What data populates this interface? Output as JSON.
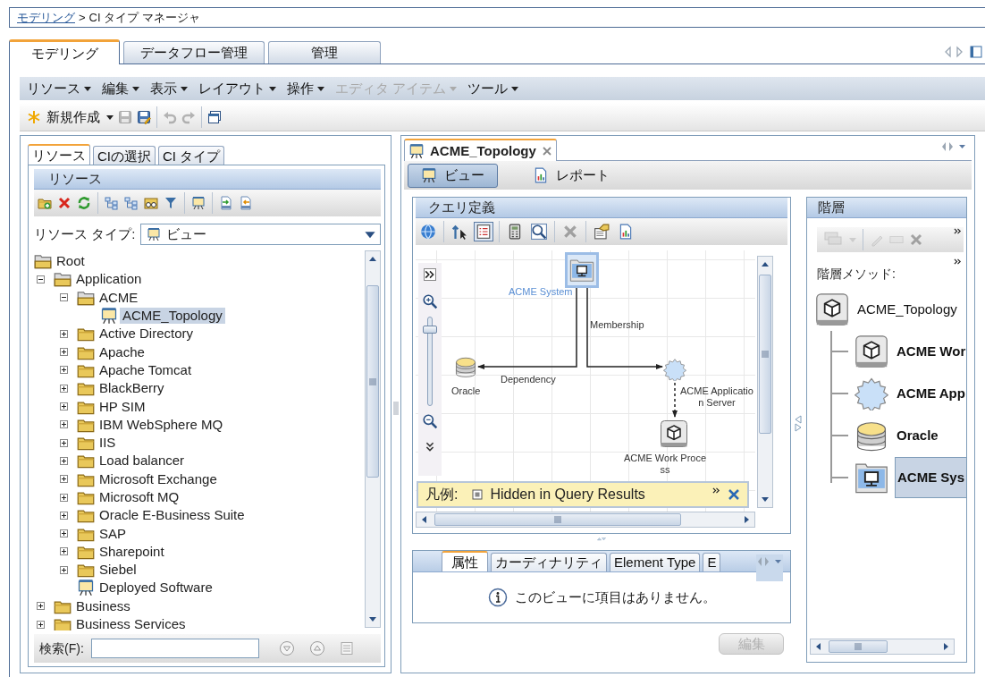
{
  "breadcrumb": {
    "items": [
      {
        "text": "モデリング",
        "link": true
      },
      {
        "text": "CI タイプ マネージャ",
        "link": false
      }
    ],
    "separator": ">"
  },
  "main_tabs": [
    {
      "label": "モデリング",
      "selected": true
    },
    {
      "label": "データフロー管理",
      "selected": false
    },
    {
      "label": "管理",
      "selected": false
    }
  ],
  "menu": [
    {
      "label": "リソース",
      "disabled": false
    },
    {
      "label": "編集",
      "disabled": false
    },
    {
      "label": "表示",
      "disabled": false
    },
    {
      "label": "レイアウト",
      "disabled": false
    },
    {
      "label": "操作",
      "disabled": false
    },
    {
      "label": "エディタ アイテム",
      "disabled": true
    },
    {
      "label": "ツール",
      "disabled": false
    }
  ],
  "toolbar": [
    {
      "kind": "new",
      "label": "新規作成",
      "disabled": false
    },
    {
      "kind": "save",
      "disabled": true
    },
    {
      "kind": "save_as",
      "disabled": false
    },
    {
      "kind": "undo",
      "disabled": true
    },
    {
      "kind": "redo",
      "disabled": true
    },
    {
      "kind": "window",
      "disabled": false
    }
  ],
  "left_panel": {
    "tabs": [
      {
        "label": "リソース",
        "selected": true
      },
      {
        "label": "CIの選択",
        "selected": false
      },
      {
        "label": "CI タイプ",
        "selected": false
      }
    ],
    "title": "リソース",
    "resource_type": {
      "label": "リソース タイプ:",
      "value": "ビュー"
    },
    "tree": [
      {
        "label": "Root",
        "kind": "folder",
        "expanded": true,
        "selected": false,
        "children": [
          {
            "label": "Application",
            "kind": "folder",
            "expanded": true,
            "selected": false,
            "children": [
              {
                "label": "ACME",
                "kind": "folder",
                "expanded": true,
                "selected": false,
                "children": [
                  {
                    "label": "ACME_Topology",
                    "kind": "view",
                    "selected": true
                  }
                ]
              },
              {
                "label": "Active Directory",
                "kind": "folder",
                "expanded": false,
                "selected": false
              },
              {
                "label": "Apache",
                "kind": "folder",
                "expanded": false,
                "selected": false
              },
              {
                "label": "Apache Tomcat",
                "kind": "folder",
                "expanded": false,
                "selected": false
              },
              {
                "label": "BlackBerry",
                "kind": "folder",
                "expanded": false,
                "selected": false
              },
              {
                "label": "HP SIM",
                "kind": "folder",
                "expanded": false,
                "selected": false
              },
              {
                "label": "IBM WebSphere MQ",
                "kind": "folder",
                "expanded": false,
                "selected": false
              },
              {
                "label": "IIS",
                "kind": "folder",
                "expanded": false,
                "selected": false
              },
              {
                "label": "Load balancer",
                "kind": "folder",
                "expanded": false,
                "selected": false
              },
              {
                "label": "Microsoft Exchange",
                "kind": "folder",
                "expanded": false,
                "selected": false
              },
              {
                "label": "Microsoft MQ",
                "kind": "folder",
                "expanded": false,
                "selected": false
              },
              {
                "label": "Oracle E-Business Suite",
                "kind": "folder",
                "expanded": false,
                "selected": false
              },
              {
                "label": "SAP",
                "kind": "folder",
                "expanded": false,
                "selected": false
              },
              {
                "label": "Sharepoint",
                "kind": "folder",
                "expanded": false,
                "selected": false
              },
              {
                "label": "Siebel",
                "kind": "folder",
                "expanded": false,
                "selected": false
              },
              {
                "label": "Deployed Software",
                "kind": "view",
                "selected": false
              }
            ]
          },
          {
            "label": "Business",
            "kind": "folder",
            "expanded": false,
            "selected": false
          },
          {
            "label": "Business Services",
            "kind": "folder",
            "expanded": false,
            "selected": false
          }
        ]
      }
    ],
    "search": {
      "label": "検索(F):"
    }
  },
  "editor": {
    "tab": {
      "label": "ACME_Topology",
      "selected": true
    },
    "views": [
      {
        "label": "ビュー",
        "selected": true
      },
      {
        "label": "レポート",
        "selected": false
      }
    ],
    "query": {
      "title": "クエリ定義",
      "toolbar": [
        {
          "kind": "globe",
          "selected": false,
          "disabled": false
        },
        {
          "kind": "pointer",
          "selected": false,
          "disabled": false
        },
        {
          "kind": "list",
          "selected": true,
          "disabled": false
        },
        {
          "kind": "calculator",
          "selected": false,
          "disabled": false
        },
        {
          "kind": "search",
          "selected": false,
          "disabled": false
        },
        {
          "kind": "delete",
          "selected": false,
          "disabled": true
        },
        {
          "kind": "properties",
          "selected": false,
          "disabled": false
        },
        {
          "kind": "report",
          "selected": false,
          "disabled": false
        }
      ],
      "zoom": {
        "level": 0.9
      },
      "nodes": [
        {
          "kind": "computer",
          "label_lines": [
            "ACME System"
          ],
          "selected": true
        },
        {
          "kind": "database",
          "label_lines": [
            "Oracle"
          ],
          "selected": false
        },
        {
          "kind": "gear",
          "label_lines": [
            "ACME Applicatio",
            "n Server"
          ],
          "selected": false
        },
        {
          "kind": "cube",
          "label_lines": [
            "ACME Work Proce",
            "ss"
          ],
          "selected": false
        }
      ],
      "edges": [
        {
          "label": "Dependency"
        },
        {
          "label": "Membership"
        }
      ],
      "legend": {
        "label": "凡例:",
        "items": [
          "Hidden in Query Results"
        ]
      }
    },
    "detail_tabs": [
      {
        "label": "属性",
        "selected": true
      },
      {
        "label": "カーディナリティ",
        "selected": false
      },
      {
        "label": "Element Type",
        "selected": false
      },
      {
        "label": "E",
        "selected": false
      }
    ],
    "message": "このビューに項目はありません。",
    "edit_button": {
      "label": "編集",
      "disabled": true
    }
  },
  "hierarchy": {
    "title": "階層",
    "method_label": "階層メソッド:",
    "tree": [
      {
        "label": "ACME_Topology",
        "kind": "cube",
        "selected": false,
        "children": [
          {
            "label": "ACME Wor",
            "kind": "cube",
            "selected": false
          },
          {
            "label": "ACME App",
            "kind": "gear",
            "selected": false
          },
          {
            "label": "Oracle",
            "kind": "database",
            "selected": false
          },
          {
            "label": "ACME Sys",
            "kind": "computer",
            "selected": true
          }
        ]
      }
    ]
  }
}
